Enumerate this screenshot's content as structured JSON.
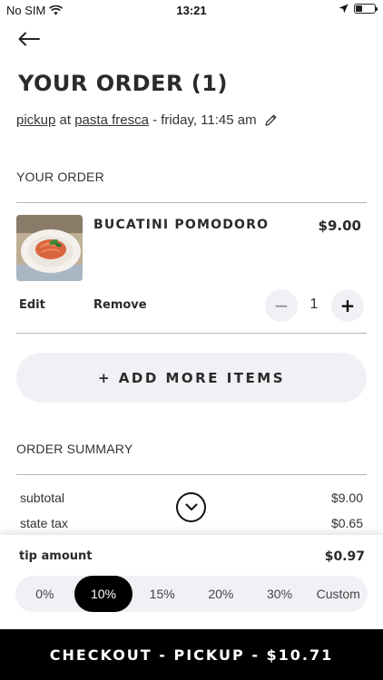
{
  "status_bar": {
    "carrier": "No SIM",
    "time": "13:21",
    "battery_level": 0.35
  },
  "header": {
    "title": "YOUR ORDER (1)",
    "pickup": {
      "mode": "pickup",
      "at": " at ",
      "restaurant": "pasta fresca",
      "schedule": " - friday, 11:45 am"
    }
  },
  "order": {
    "section_label": "YOUR ORDER",
    "items": [
      {
        "name": "BUCATINI POMODORO",
        "price": "$9.00",
        "edit_label": "Edit",
        "remove_label": "Remove",
        "quantity": "1",
        "minus_label": "−",
        "plus_label": "+"
      }
    ],
    "add_more_label": "+ ADD MORE ITEMS"
  },
  "summary": {
    "section_label": "ORDER SUMMARY",
    "rows": [
      {
        "label": "subtotal",
        "value": "$9.00"
      },
      {
        "label": "state tax",
        "value": "$0.65"
      }
    ]
  },
  "tip": {
    "label": "tip amount",
    "value": "$0.97",
    "options": [
      "0%",
      "10%",
      "15%",
      "20%",
      "30%",
      "Custom"
    ],
    "selected": "10%"
  },
  "checkout": {
    "label": "CHECKOUT - PICKUP - $10.71"
  },
  "icons": {
    "back": "arrow-left-icon",
    "edit": "pencil-icon",
    "expand": "chevron-down-icon",
    "wifi": "wifi-icon",
    "location": "location-arrow-icon",
    "battery": "battery-icon"
  },
  "colors": {
    "accent": "#000000",
    "pill_background": "#f1f0f5",
    "text": "#2a2a2a"
  }
}
